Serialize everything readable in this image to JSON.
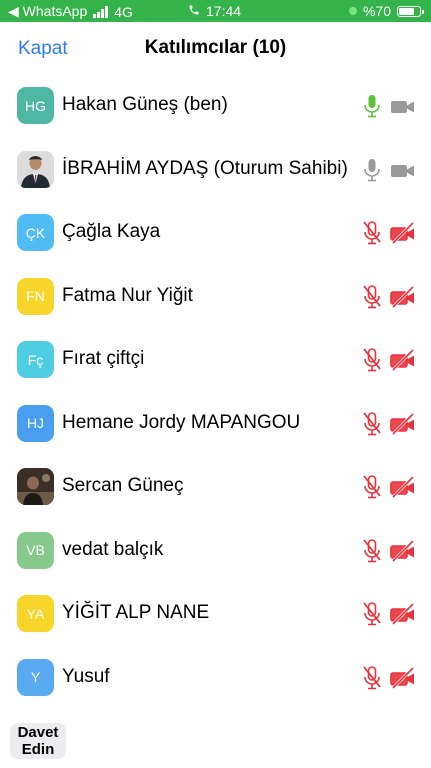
{
  "status_bar": {
    "back_app": "◀ WhatsApp",
    "network": "4G",
    "time": "17:44",
    "battery": "%70",
    "battery_level": 0.7
  },
  "header": {
    "close_label": "Kapat",
    "title": "Katılımcılar (10)"
  },
  "participants": [
    {
      "initials": "HG",
      "name": "Hakan Güneş (ben)",
      "avatar_color": "#4fb8a5",
      "mic": "on",
      "cam": "off"
    },
    {
      "initials": "",
      "name": "İBRAHİM AYDAŞ (Oturum Sahibi)",
      "avatar_color": "#c9c9c9",
      "avatar_type": "photo-suit",
      "mic": "idle",
      "cam": "idle"
    },
    {
      "initials": "ÇK",
      "name": "Çağla Kaya",
      "avatar_color": "#4fbcf3",
      "mic": "muted",
      "cam": "muted"
    },
    {
      "initials": "FN",
      "name": "Fatma Nur Yiğit",
      "avatar_color": "#f8d52a",
      "mic": "muted",
      "cam": "muted"
    },
    {
      "initials": "Fç",
      "name": "Fırat çiftçi",
      "avatar_color": "#4fcde3",
      "mic": "muted",
      "cam": "muted"
    },
    {
      "initials": "HJ",
      "name": "Hemane Jordy MAPANGOU",
      "avatar_color": "#4a9ef0",
      "mic": "muted",
      "cam": "muted"
    },
    {
      "initials": "",
      "name": "Sercan Güneç",
      "avatar_color": "#5a4a3a",
      "avatar_type": "photo-dark",
      "mic": "muted",
      "cam": "muted"
    },
    {
      "initials": "VB",
      "name": "vedat balçık",
      "avatar_color": "#86c98a",
      "mic": "muted",
      "cam": "muted"
    },
    {
      "initials": "YA",
      "name": "YİĞİT ALP NANE",
      "avatar_color": "#f8d52a",
      "mic": "muted",
      "cam": "muted"
    },
    {
      "initials": "Y",
      "name": "Yusuf",
      "avatar_color": "#5aaaf2",
      "mic": "muted",
      "cam": "muted"
    }
  ],
  "footer": {
    "invite_line1": "Davet",
    "invite_line2": "Edin"
  },
  "colors": {
    "status_bar": "#34b34a",
    "accent": "#2b7cf6",
    "mic_on": "#5ec13a",
    "muted": "#e8333c",
    "idle": "#9a9a9a"
  }
}
